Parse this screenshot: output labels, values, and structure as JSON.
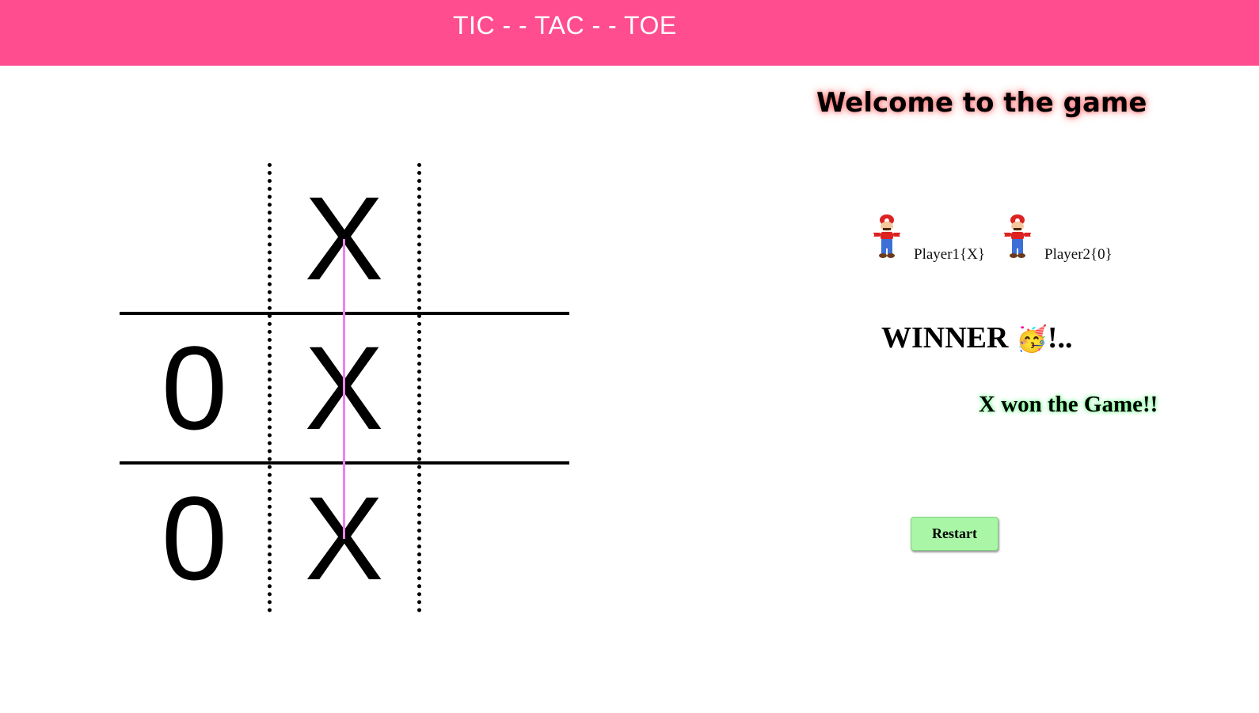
{
  "header": {
    "title": "TIC - - TAC - - TOE",
    "background_color": "#ff4d8f"
  },
  "board": {
    "cells": [
      "",
      "X",
      "",
      "0",
      "X",
      "",
      "0",
      "X",
      ""
    ],
    "winning_line_color": "#f080f0"
  },
  "panel": {
    "welcome": "Welcome to the game",
    "players": [
      {
        "label": "Player1{X}",
        "avatar_icon": "mario-avatar-icon"
      },
      {
        "label": "Player2{0}",
        "avatar_icon": "mario-avatar-icon"
      }
    ],
    "winner_label": "WINNER",
    "winner_emoji": "🥳",
    "winner_suffix": "!..",
    "result": "X won the Game!!",
    "restart_label": "Restart"
  }
}
